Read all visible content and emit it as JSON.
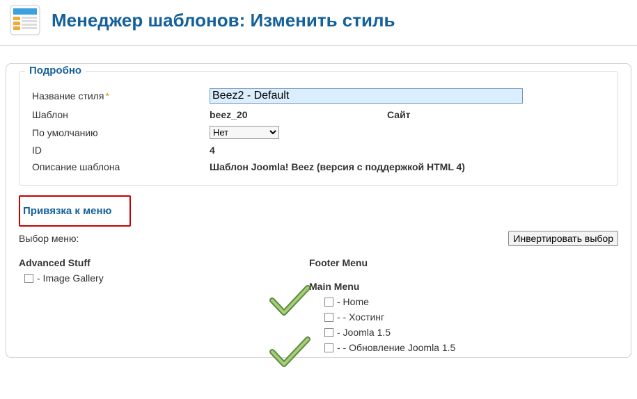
{
  "header": {
    "title": "Менеджер шаблонов: Изменить стиль"
  },
  "details": {
    "legend": "Подробно",
    "style_name_label": "Название стиля",
    "style_name_value": "Beez2 - Default",
    "template_label": "Шаблон",
    "template_value": "beez_20",
    "location_value": "Сайт",
    "default_label": "По умолчанию",
    "default_value": "Нет",
    "id_label": "ID",
    "id_value": "4",
    "desc_label": "Описание шаблона",
    "desc_value": "Шаблон Joomla! Beez (версия с поддержкой HTML 4)"
  },
  "binding": {
    "legend": "Привязка к меню",
    "select_label": "Выбор меню:",
    "invert_label": "Инвертировать выбор"
  },
  "menus": {
    "advanced": {
      "heading": "Advanced Stuff",
      "items": [
        {
          "label": "- Image Gallery"
        }
      ]
    },
    "footer": {
      "heading": "Footer Menu"
    },
    "main": {
      "heading": "Main Menu",
      "items": [
        {
          "label": "- Home"
        },
        {
          "label": "- - Хостинг"
        },
        {
          "label": "- Joomla 1.5"
        },
        {
          "label": "- - Обновление Joomla 1.5"
        }
      ]
    }
  }
}
